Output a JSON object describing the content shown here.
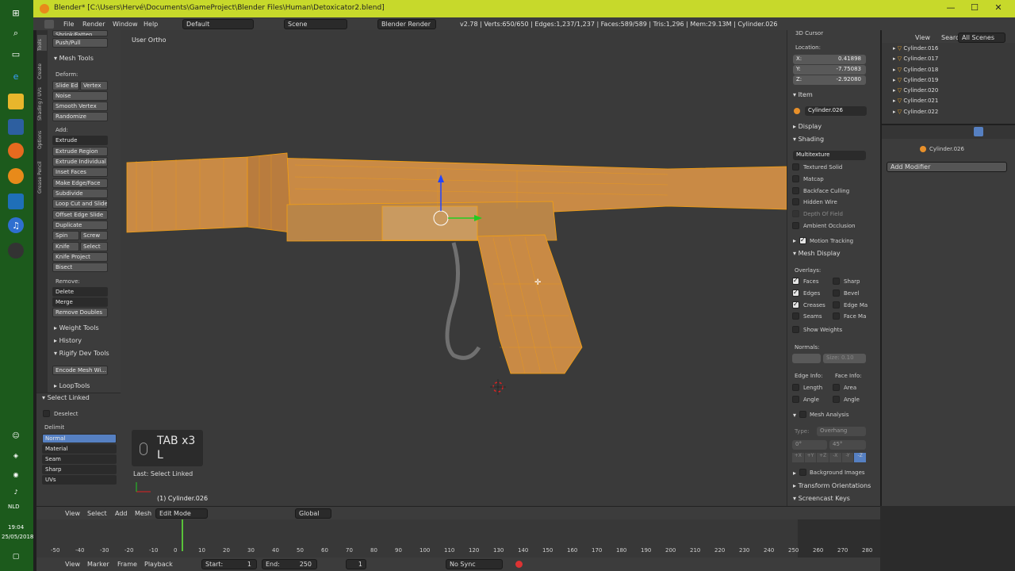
{
  "window": {
    "title": "Blender* [C:\\Users\\Hervé\\Documents\\GameProject\\Blender Files\\Human\\Detoxicator2.blend]"
  },
  "taskbar": {
    "time": "19:04",
    "date": "25/05/2018",
    "lang": "NLD"
  },
  "infobar": {
    "menus": [
      "File",
      "Render",
      "Window",
      "Help"
    ],
    "layout": "Default",
    "scene": "Scene",
    "engine": "Blender Render",
    "stats": "v2.78 | Verts:650/650 | Edges:1,237/1,237 | Faces:589/589 | Tris:1,296 | Mem:29.13M | Cylinder.026"
  },
  "toolshelf": {
    "tabs": [
      "Tools",
      "Create",
      "Shading / UVs",
      "Options",
      "Grease Pencil"
    ],
    "top_items": [
      "Shrink/Fatten",
      "Push/Pull"
    ],
    "mesh_tools": "Mesh Tools",
    "deform": "Deform:",
    "slide_edge": "Slide Ed",
    "vertex": "Vertex",
    "noise": "Noise",
    "smooth_vertex": "Smooth Vertex",
    "randomize": "Randomize",
    "add": "Add:",
    "extrude": "Extrude",
    "extrude_region": "Extrude Region",
    "extrude_individual": "Extrude Individual",
    "inset_faces": "Inset Faces",
    "make_edge_face": "Make Edge/Face",
    "subdivide": "Subdivide",
    "loop_cut": "Loop Cut and Slide",
    "offset_edge": "Offset Edge Slide",
    "duplicate": "Duplicate",
    "spin": "Spin",
    "screw": "Screw",
    "knife": "Knife",
    "select": "Select",
    "knife_project": "Knife Project",
    "bisect": "Bisect",
    "remove": "Remove:",
    "delete": "Delete",
    "merge": "Merge",
    "remove_doubles": "Remove Doubles",
    "weight_tools": "Weight Tools",
    "history": "History",
    "rigify": "Rigify Dev Tools",
    "encode_mesh": "Encode Mesh Wi...",
    "looptools": "LoopTools",
    "select_linked": "Select Linked",
    "deselect": "Deselect",
    "delimit": "Delimit",
    "delimit_options": [
      "Normal",
      "Material",
      "Seam",
      "Sharp",
      "UVs"
    ]
  },
  "viewport": {
    "label": "User Ortho",
    "key_display_line1": "TAB x3",
    "key_display_line2": "L",
    "last_op": "Last: Select Linked",
    "object_label": "(1) Cylinder.026"
  },
  "rightpanel": {
    "cursor_header": "3D Cursor",
    "location": "Location:",
    "x": "X:",
    "x_val": "0.41898",
    "y": "Y:",
    "y_val": "-7.75083",
    "z": "Z:",
    "z_val": "-2.92080",
    "item": "Item",
    "item_name": "Cylinder.026",
    "display": "Display",
    "shading": "Shading",
    "shading_mode": "Multitexture",
    "textured_solid": "Textured Solid",
    "matcap": "Matcap",
    "backface": "Backface Culling",
    "hidden_wire": "Hidden Wire",
    "depth_field": "Depth Of Field",
    "ambient": "Ambient Occlusion",
    "motion": "Motion Tracking",
    "mesh_display": "Mesh Display",
    "overlays": "Overlays:",
    "faces": "Faces",
    "sharp": "Sharp",
    "edges": "Edges",
    "bevel": "Bevel",
    "creases": "Creases",
    "edge_ma": "Edge Ma",
    "seams": "Seams",
    "face_ma": "Face Ma",
    "show_weights": "Show Weights",
    "normals": "Normals:",
    "size": "Size: 0.10",
    "edge_info": "Edge Info:",
    "face_info": "Face Info:",
    "length": "Length",
    "area": "Area",
    "angle1": "Angle",
    "angle2": "Angle",
    "mesh_analysis": "Mesh Analysis",
    "type": "Type:",
    "type_val": "Overhang",
    "ma_val1": "0°",
    "ma_val2": "45°",
    "axes": [
      "+X",
      "+Y",
      "+Z",
      "-X",
      "-Y",
      "-Z"
    ],
    "bg_images": "Background Images",
    "transform_orient": "Transform Orientations",
    "screencast": "Screencast Keys"
  },
  "outliner": {
    "view": "View",
    "search": "Search",
    "all_scenes": "All Scenes",
    "items": [
      "Cylinder.016",
      "Cylinder.017",
      "Cylinder.018",
      "Cylinder.019",
      "Cylinder.020",
      "Cylinder.021",
      "Cylinder.022"
    ]
  },
  "props": {
    "object": "Cylinder.026",
    "add_modifier": "Add Modifier"
  },
  "viewheader": {
    "view": "View",
    "select": "Select",
    "add": "Add",
    "mesh": "Mesh",
    "mode": "Edit Mode",
    "orientation": "Global"
  },
  "timeline": {
    "ticks": [
      "-50",
      "-40",
      "-30",
      "-20",
      "-10",
      "0",
      "10",
      "20",
      "30",
      "40",
      "50",
      "60",
      "70",
      "80",
      "90",
      "100",
      "110",
      "120",
      "130",
      "140",
      "150",
      "160",
      "170",
      "180",
      "190",
      "200",
      "210",
      "220",
      "230",
      "240",
      "250",
      "260",
      "270",
      "280"
    ],
    "menus": [
      "View",
      "Marker",
      "Frame",
      "Playback"
    ],
    "start": "Start:",
    "start_val": "1",
    "end": "End:",
    "end_val": "250",
    "current": "1",
    "sync": "No Sync"
  },
  "colors": {
    "titlebar": "#c7d92b",
    "taskbar": "#1c5a1c",
    "mesh": "#c98a45",
    "wire": "#f5a00f",
    "accent": "#5680c2"
  }
}
